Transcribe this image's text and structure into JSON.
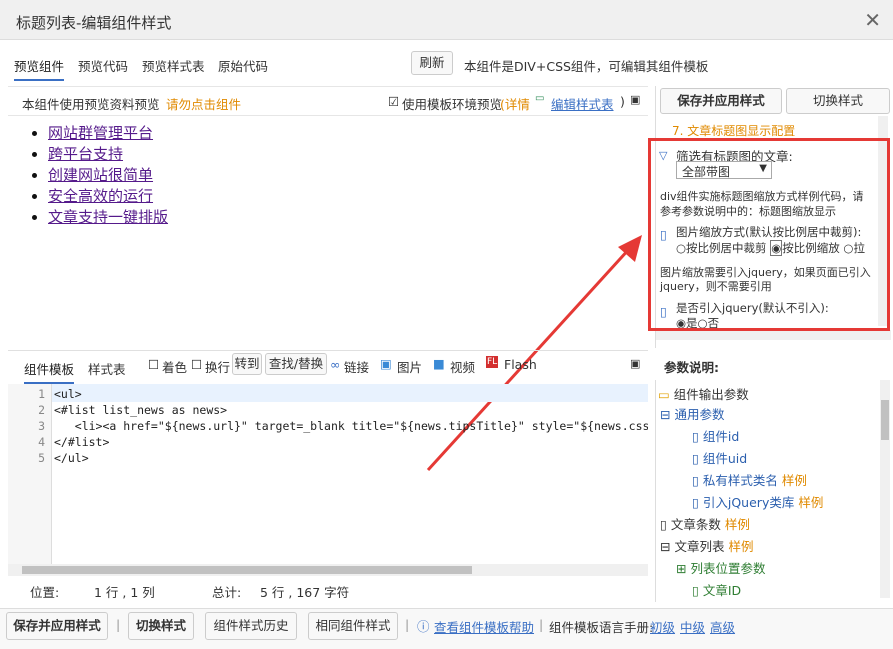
{
  "window": {
    "title": "标题列表-编辑组件样式"
  },
  "tabs": [
    {
      "label": "预览组件",
      "active": true
    },
    {
      "label": "预览代码"
    },
    {
      "label": "预览样式表"
    },
    {
      "label": "原始代码"
    }
  ],
  "toolbar": {
    "refresh": "刷新",
    "desc": "本组件是DIV+CSS组件，可编辑其组件模板"
  },
  "preview_bar": {
    "label": "本组件使用预览资料预览",
    "hint": "请勿点击组件",
    "checkbox_label": "使用模板环境预览",
    "details": "(详情",
    "edit_style": "编辑样式表",
    "close_paren": ")"
  },
  "preview_list": [
    "网站群管理平台",
    "跨平台支持",
    "创建网站很简单",
    "安全高效的运行",
    "文章支持一键排版"
  ],
  "right_panel": {
    "save": "保存并应用样式",
    "switch": "切换样式",
    "section": "7. 文章标题图显示配置",
    "filter_label": "筛选有标题图的文章:",
    "filter_value": "全部带图",
    "desc1": "div组件实施标题图缩放方式样例代码，请",
    "desc2": "参考参数说明中的：标题图缩放显示",
    "scale_label": "图片缩放方式(默认按比例居中裁剪):",
    "scale_opts": [
      "按比例居中裁剪",
      "按比例缩放",
      "拉"
    ],
    "jq1": "图片缩放需要引入jquery，如果页面已引入",
    "jq2": "jquery，则不需要引用",
    "jq_label": "是否引入jquery(默认不引入):",
    "jq_opts": [
      "是",
      "否"
    ]
  },
  "editor_tabs": {
    "template": "组件模板",
    "style": "样式表"
  },
  "editor_tools": {
    "color": "着色",
    "wrap": "换行",
    "goto": "转到",
    "find": "查找/替换",
    "link": "链接",
    "image": "图片",
    "video": "视频",
    "flash": "Flash"
  },
  "code_lines": [
    "<ul>",
    "<#list list_news as news>",
    "   <li><a href=\"${news.url}\" target=_blank title=\"${news.tipsTitle}\" style=\"${news.cssTit",
    "</#list>",
    "</ul>"
  ],
  "line_numbers": [
    "1",
    "2",
    "3",
    "4",
    "5"
  ],
  "status": {
    "pos_label": "位置:",
    "pos": "1 行 , 1 列",
    "total_label": "总计:",
    "total": "5 行 , 167 字符"
  },
  "params": {
    "title": "参数说明:",
    "tree": [
      {
        "label": "组件输出参数"
      },
      {
        "label": "通用参数"
      },
      {
        "label": "组件id"
      },
      {
        "label": "组件uid"
      },
      {
        "label": "私有样式类名",
        "sample": "样例"
      },
      {
        "label": "引入jQuery类库",
        "sample": "样例"
      },
      {
        "label": "文章条数",
        "sample": "样例"
      },
      {
        "label": "文章列表",
        "sample": "样例"
      },
      {
        "label": "列表位置参数"
      },
      {
        "label": "文章ID"
      }
    ]
  },
  "bottom": {
    "save": "保存并应用样式",
    "switch": "切换样式",
    "history": "组件样式历史",
    "same": "相同组件样式",
    "help": "查看组件模板帮助",
    "manual": "组件模板语言手册:",
    "levels": [
      "初级",
      "中级",
      "高级"
    ]
  },
  "colors": {
    "red": "#e53935",
    "link": "#551a8b",
    "accent": "#3a6fc4",
    "orange": "#e08a00"
  }
}
